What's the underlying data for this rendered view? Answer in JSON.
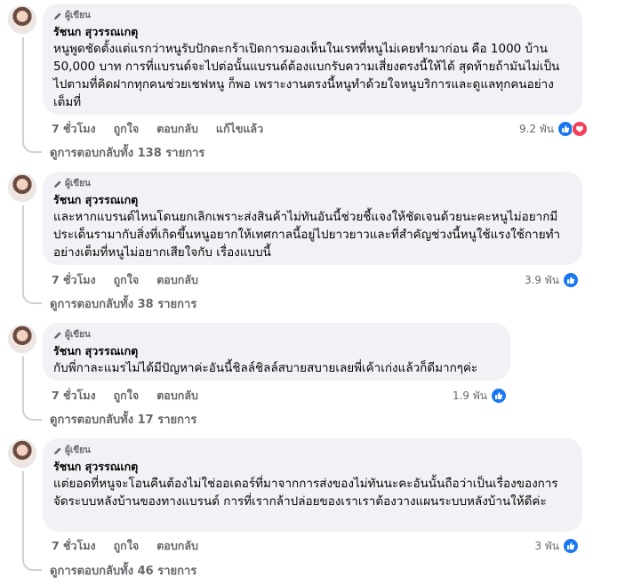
{
  "comments": [
    {
      "badge": "ผู้เขียน",
      "author": "รัชนก สุวรรณเกตุ",
      "text": "หนูพูดชัดตั้งแต่แรกว่าหนูรับปักตะกร้าเปิดการมองเห็นในเรทที่หนูไม่เคยทำมาก่อน คือ 1000 บ้าน 50,000 บาท การที่แบรนด์จะไปต่อนั้นแบรนด์ต้องแบกรับความเสี่ยงตรงนี้ให้ได้ สุดท้ายถ้ามันไม่เป็นไปตามที่คิดฝากทุกคนช่วยเชฟหนู ก็พอ เพราะงานตรงนี้หนูทำด้วยใจหนูบริการและดูแลทุกคนอย่างเต็มที่",
      "time": "7 ชั่วโมง",
      "like": "ถูกใจ",
      "reply": "ตอบกลับ",
      "edited": "แก้ไขแล้ว",
      "reaction_count": "9.2 พัน",
      "reactions": [
        "like-icon",
        "love-icon"
      ],
      "replies_label": "ดูการตอบกลับทั้ง 138 รายการ"
    },
    {
      "badge": "ผู้เขียน",
      "author": "รัชนก สุวรรณเกตุ",
      "text": "และหากแบรนด์ไหนโดนยกเลิกเพราะส่งสินค้าไม่ทันอันนี้ช่วยชี้แจงให้ชัดเจนด้วยนะคะหนูไม่อยากมีประเด็นรามากับสิ่งที่เกิดขึ้นหนูอยากให้เทศกาลนี้อยู่ไปยาวยาวและที่สำคัญช่วงนี้หนูใช้แรงใช้กายทำอย่างเต็มที่หนูไม่อยากเสียใจกับ เรื่องแบบนี้",
      "time": "7 ชั่วโมง",
      "like": "ถูกใจ",
      "reply": "ตอบกลับ",
      "reaction_count": "3.9 พัน",
      "reactions": [
        "like-icon"
      ],
      "replies_label": "ดูการตอบกลับทั้ง 38 รายการ"
    },
    {
      "badge": "ผู้เขียน",
      "author": "รัชนก สุวรรณเกตุ",
      "text": "กับพี่กาละแมรไม่ได้มีปัญหาค่ะอันนี้ชิลล์ชิลล์สบายสบายเลยพี่เค้าเก่งแล้วก็ดีมากๆค่ะ",
      "time": "7 ชั่วโมง",
      "like": "ถูกใจ",
      "reply": "ตอบกลับ",
      "reaction_count": "1.9 พัน",
      "reactions": [
        "like-icon"
      ],
      "replies_label": "ดูการตอบกลับทั้ง 17 รายการ"
    },
    {
      "badge": "ผู้เขียน",
      "author": "รัชนก สุวรรณเกตุ",
      "text": "แต่ยอดที่หนูจะโอนคืนต้องไม่ใช่ออเดอร์ที่มาจากการส่งของไม่ทันนะคะอันนั้นถือว่าเป็นเรื่องของการจัดระบบหลังบ้านของทางแบรนด์ การที่เรากล้าปล่อยของเราเราต้องวางแผนระบบหลังบ้านให้ดีค่ะ",
      "time": "7 ชั่วโมง",
      "like": "ถูกใจ",
      "reply": "ตอบกลับ",
      "reaction_count": "3 พัน",
      "reactions": [
        "like-icon"
      ],
      "replies_label": "ดูการตอบกลับทั้ง 46 รายการ"
    }
  ],
  "colors": {
    "like": "#1877f2",
    "love": "#f33e58",
    "bubble": "#f0f2f5",
    "meta": "#65676b"
  }
}
